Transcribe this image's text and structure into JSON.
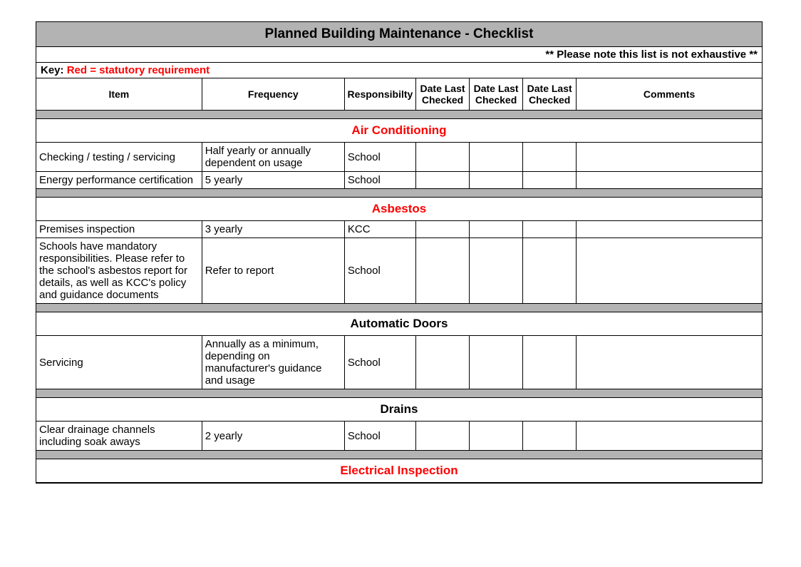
{
  "title": "Planned Building Maintenance - Checklist",
  "note": "** Please note this list is not exhaustive **",
  "key_label": "Key:  ",
  "key_red": "Red = statutory requirement",
  "headers": {
    "item": "Item",
    "frequency": "Frequency",
    "responsibility": "Responsibilty",
    "date1": "Date Last Checked",
    "date2": "Date Last Checked",
    "date3": "Date Last Checked",
    "comments": "Comments"
  },
  "sections": [
    {
      "name": "Air Conditioning",
      "statutory": true,
      "rows": [
        {
          "item": "Checking / testing / servicing",
          "frequency": "Half yearly or annually dependent on usage",
          "responsibility": "School",
          "d1": "",
          "d2": "",
          "d3": "",
          "comments": ""
        },
        {
          "item": "Energy performance certification",
          "frequency": "5 yearly",
          "responsibility": "School",
          "d1": "",
          "d2": "",
          "d3": "",
          "comments": ""
        }
      ]
    },
    {
      "name": "Asbestos",
      "statutory": true,
      "rows": [
        {
          "item": "Premises inspection",
          "frequency": "3 yearly",
          "responsibility": "KCC",
          "d1": "",
          "d2": "",
          "d3": "",
          "comments": ""
        },
        {
          "item": "Schools have mandatory responsibilities. Please refer to the school's asbestos report for details, as well as KCC's policy and guidance documents",
          "frequency": "Refer to report",
          "responsibility": "School",
          "d1": "",
          "d2": "",
          "d3": "",
          "comments": ""
        }
      ]
    },
    {
      "name": "Automatic Doors",
      "statutory": false,
      "rows": [
        {
          "item": "Servicing",
          "frequency": "Annually as a minimum, depending on manufacturer's guidance and usage",
          "responsibility": "School",
          "d1": "",
          "d2": "",
          "d3": "",
          "comments": ""
        }
      ]
    },
    {
      "name": "Drains",
      "statutory": false,
      "rows": [
        {
          "item": "Clear drainage channels including soak aways",
          "frequency": "2 yearly",
          "responsibility": "School",
          "d1": "",
          "d2": "",
          "d3": "",
          "comments": ""
        }
      ]
    },
    {
      "name": "Electrical Inspection",
      "statutory": true,
      "rows": []
    }
  ]
}
